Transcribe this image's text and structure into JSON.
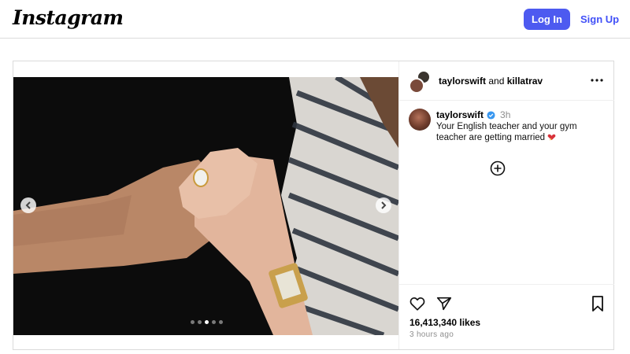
{
  "header": {
    "logo_text": "Instagram",
    "login_label": "Log In",
    "signup_label": "Sign Up"
  },
  "post": {
    "header": {
      "user": "taylorswift",
      "connector": "and",
      "collab": "killatrav"
    },
    "carousel": {
      "slide_count": 5,
      "active_index": 2
    },
    "caption": {
      "user": "taylorswift",
      "time": "3h",
      "text": "Your English teacher and your gym teacher are getting married",
      "emoji": "heart-emoji"
    },
    "likes": "16,413,340 likes",
    "time_ago": "3 hours ago"
  },
  "icons": {
    "more": "more-options-icon",
    "like": "heart-icon",
    "share": "send-icon",
    "save": "bookmark-icon",
    "add_comment": "add-circle-icon",
    "prev": "chevron-left-icon",
    "next": "chevron-right-icon",
    "verified": "verified-badge-icon"
  },
  "colors": {
    "accent": "#4d5af0",
    "link": "#4150f7",
    "verified": "#3897f0",
    "muted": "#8e8e8e"
  }
}
